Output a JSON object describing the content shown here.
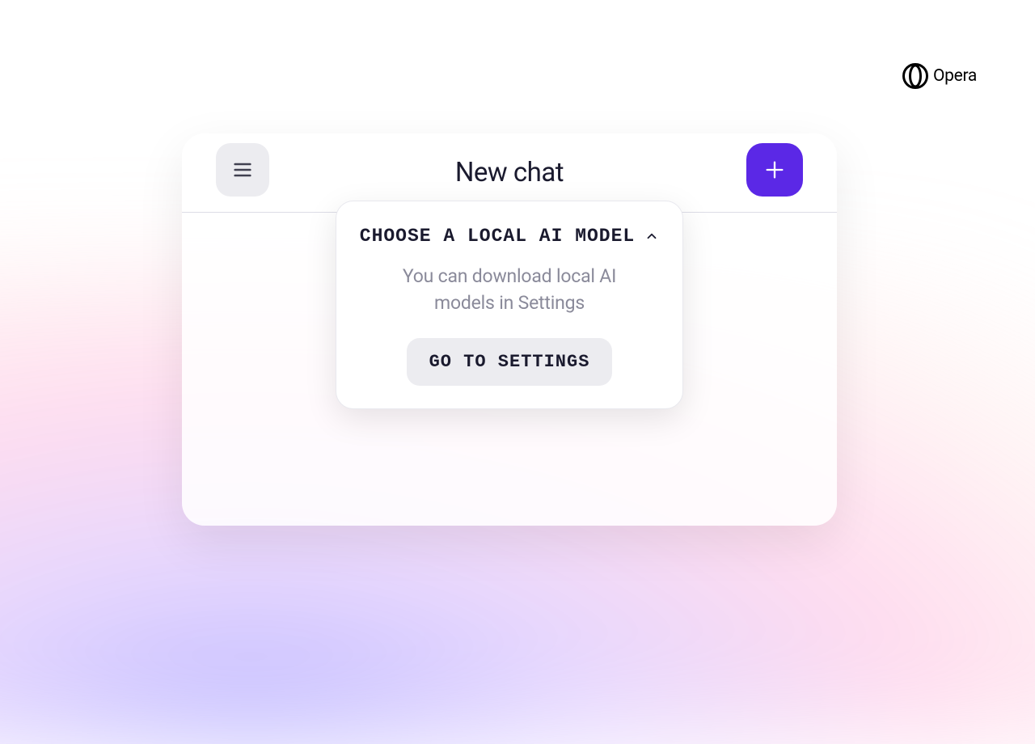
{
  "brand": {
    "name": "Opera",
    "icon": "opera-logo-icon"
  },
  "header": {
    "title": "New chat",
    "menu_icon": "hamburger-icon",
    "add_icon": "plus-icon"
  },
  "dropdown": {
    "title": "CHOOSE A LOCAL AI MODEL",
    "chevron_icon": "chevron-up-icon",
    "subtitle": "You can download local AI models in Settings",
    "button_label": "GO TO SETTINGS"
  },
  "colors": {
    "accent": "#5b28e6",
    "neutral_bg": "#ececf0",
    "text_primary": "#1a1a2e",
    "text_secondary": "#8a8a9a"
  }
}
